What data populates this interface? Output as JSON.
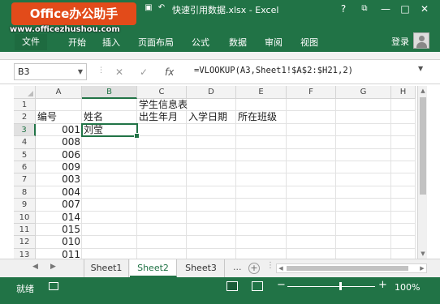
{
  "window": {
    "title": "快速引用数据.xlsx - Excel",
    "help": "?",
    "restore_icon": "ribbon-display-icon",
    "minimize": "—",
    "maximize": "□",
    "close": "✕"
  },
  "watermark": {
    "logo_text": "Office办公助手",
    "url": "www.officezhushou.com"
  },
  "ribbon": {
    "file": "文件",
    "tabs": [
      "开始",
      "插入",
      "页面布局",
      "公式",
      "数据",
      "审阅",
      "视图"
    ],
    "login": "登录"
  },
  "formula_bar": {
    "name_box": "B3",
    "cancel": "✕",
    "enter": "✓",
    "fx": "fx",
    "formula": "=VLOOKUP(A3,Sheet1!$A$2:$H21,2)"
  },
  "sheet": {
    "columns": [
      "A",
      "B",
      "C",
      "D",
      "E",
      "F",
      "G",
      "H"
    ],
    "rows": [
      "1",
      "2",
      "3",
      "4",
      "5",
      "6",
      "7",
      "8",
      "9",
      "10",
      "11",
      "12",
      "13"
    ],
    "selected_cell": "B3",
    "title_cell": "学生信息表",
    "headers": [
      "编号",
      "姓名",
      "出生年月",
      "入学日期",
      "所在班级"
    ],
    "ids": [
      "001",
      "008",
      "006",
      "009",
      "003",
      "004",
      "007",
      "014",
      "015",
      "010",
      "011"
    ],
    "b3_value": "刘莹"
  },
  "sheet_tabs": [
    "Sheet1",
    "Sheet2",
    "Sheet3"
  ],
  "active_sheet": "Sheet2",
  "status": {
    "ready": "就绪",
    "zoom": "100%",
    "zoom_minus": "−",
    "zoom_plus": "+"
  },
  "colors": {
    "accent": "#217346",
    "grid": "#e2e2e2",
    "header_bg": "#f3f3f3"
  }
}
